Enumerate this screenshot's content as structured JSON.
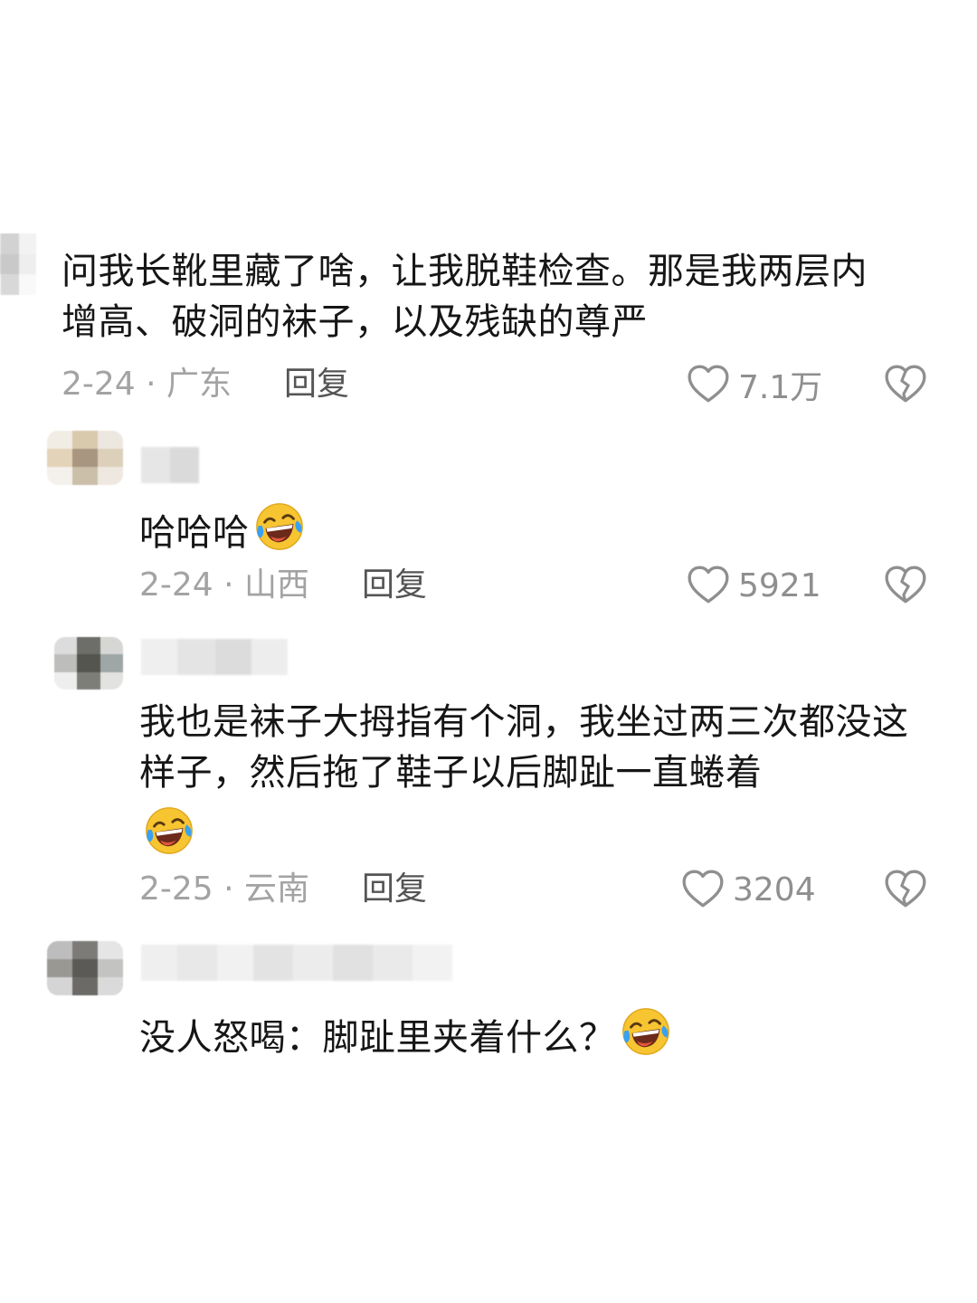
{
  "comments": [
    {
      "text": "问我长靴里藏了啥，让我脱鞋检查。那是我两层内增高、破洞的袜子，以及残缺的尊严",
      "date_location": "2-24 · 广东",
      "reply_label": "回复",
      "likes": "7.1万"
    },
    {
      "text": "哈哈哈",
      "date_location": "2-24 · 山西",
      "reply_label": "回复",
      "likes": "5921"
    },
    {
      "text": "我也是袜子大拇指有个洞，我坐过两三次都没这样子，然后拖了鞋子以后脚趾一直蜷着",
      "date_location": "2-25 · 云南",
      "reply_label": "回复",
      "likes": "3204"
    },
    {
      "text": "没人怒喝：脚趾里夹着什么？"
    }
  ],
  "icons": {
    "like": "heart-outline-icon",
    "dislike": "broken-heart-icon",
    "emoji": "laughing-crying-emoji"
  },
  "colors": {
    "text": "#161616",
    "meta": "#a3a3a3",
    "reply": "#555555",
    "icon": "#8f8f8f",
    "emoji_face": "#f7c531",
    "emoji_tear": "#3aa0f0"
  }
}
